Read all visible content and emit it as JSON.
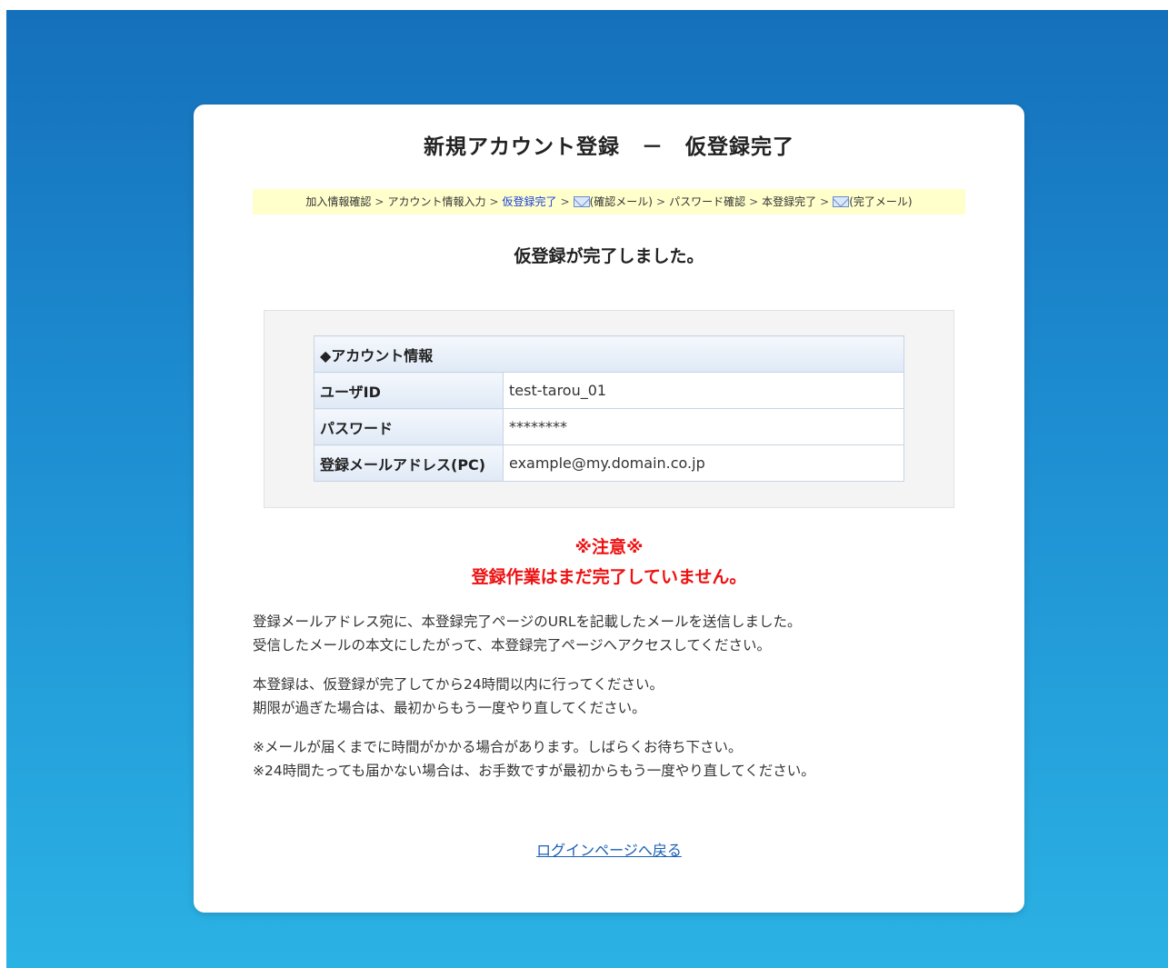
{
  "page": {
    "title": "新規アカウント登録　－　仮登録完了",
    "subtitle": "仮登録が完了しました。"
  },
  "steps": {
    "s1": "加入情報確認",
    "s2": "アカウント情報入力",
    "s3": "仮登録完了",
    "s4": "(確認メール)",
    "s5": "パスワード確認",
    "s6": "本登録完了",
    "s7": "(完了メール)",
    "separator": ">"
  },
  "account": {
    "header": "◆アカウント情報",
    "rows": [
      {
        "label": "ユーザID",
        "value": "test-tarou_01"
      },
      {
        "label": "パスワード",
        "value": "********"
      },
      {
        "label": "登録メールアドレス(PC)",
        "value": "example@my.domain.co.jp"
      }
    ]
  },
  "notice": {
    "title": "※注意※",
    "subtitle": "登録作業はまだ完了していません。"
  },
  "messages": {
    "p1_line1": "登録メールアドレス宛に、本登録完了ページのURLを記載したメールを送信しました。",
    "p1_line2": "受信したメールの本文にしたがって、本登録完了ページへアクセスしてください。",
    "p2_line1": "本登録は、仮登録が完了してから24時間以内に行ってください。",
    "p2_line2": "期限が過ぎた場合は、最初からもう一度やり直してください。",
    "p3_line1": "※メールが届くまでに時間がかかる場合があります。しばらくお待ち下さい。",
    "p3_line2": "※24時間たっても届かない場合は、お手数ですが最初からもう一度やり直してください。"
  },
  "links": {
    "back_to_login": "ログインページへ戻る"
  },
  "colors": {
    "background_top": "#1570bb",
    "background_bottom": "#2bb2e4",
    "notice": "#ee1111",
    "current_step": "#1b3fd6",
    "link": "#1a5fb4"
  },
  "icons": {
    "mail": "envelope-icon"
  }
}
